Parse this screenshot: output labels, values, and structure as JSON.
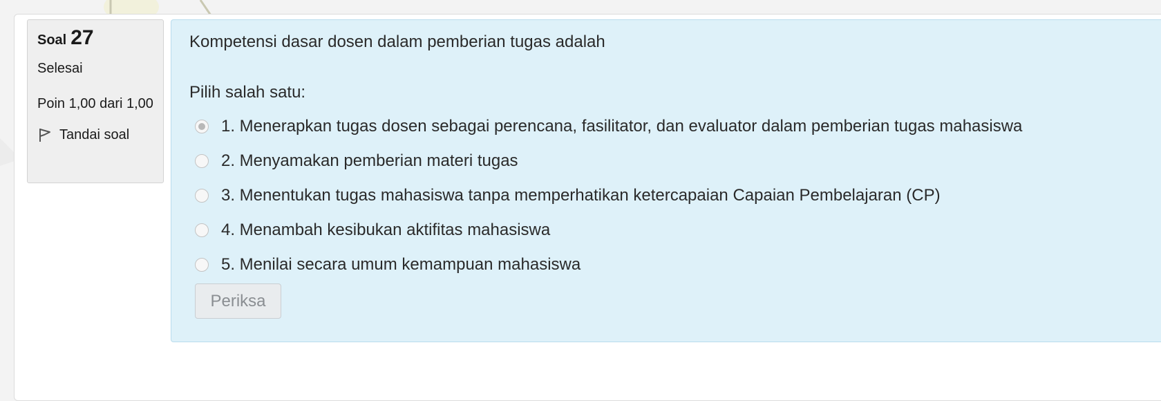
{
  "question_info": {
    "label": "Soal",
    "number": "27",
    "state": "Selesai",
    "grade": "Poin 1,00 dari 1,00",
    "flag_label": "Tandai soal",
    "flag_icon": "flag-icon"
  },
  "question": {
    "text": "Kompetensi dasar dosen dalam pemberian tugas adalah",
    "prompt": "Pilih salah satu:",
    "answers": [
      {
        "label": "1. Menerapkan tugas dosen sebagai perencana, fasilitator, dan evaluator dalam pemberian tugas mahasiswa",
        "selected": true
      },
      {
        "label": "2. Menyamakan pemberian materi tugas",
        "selected": false
      },
      {
        "label": "3. Menentukan tugas mahasiswa tanpa memperhatikan ketercapaian Capaian Pembelajaran (CP)",
        "selected": false
      },
      {
        "label": "4. Menambah kesibukan aktifitas mahasiswa",
        "selected": false
      },
      {
        "label": "5. Menilai secara umum kemampuan mahasiswa",
        "selected": false
      }
    ],
    "check_button": "Periksa"
  },
  "colors": {
    "content_bg": "#def1f9",
    "info_bg": "#efefef"
  }
}
